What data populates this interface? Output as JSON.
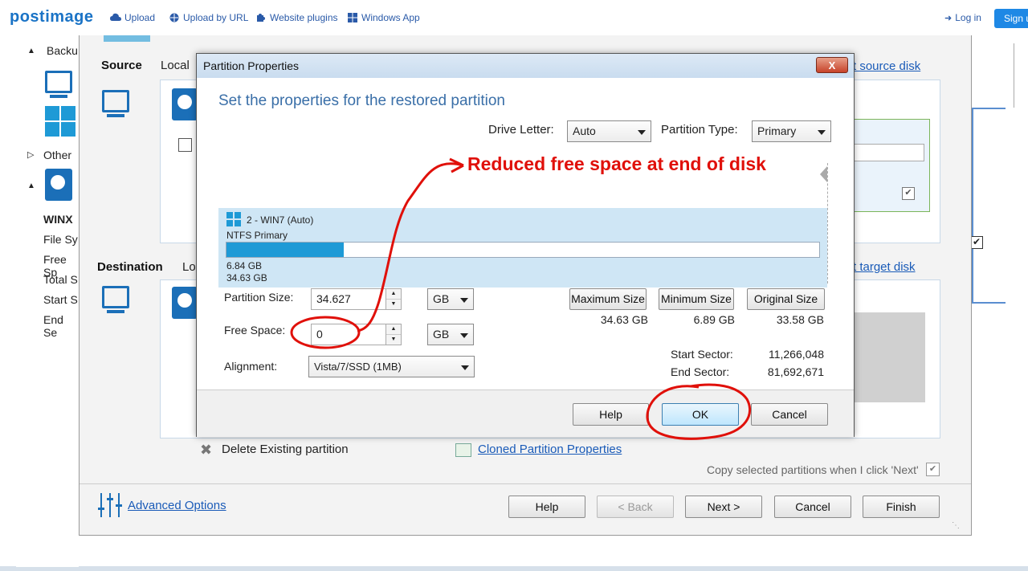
{
  "topbar": {
    "logo": "postimage",
    "nav": [
      "Upload",
      "Upload by URL",
      "Website plugins",
      "Windows App"
    ],
    "login": "Log in",
    "signup": "Sign up"
  },
  "left_panel": {
    "backup_label": "Backu",
    "other_label": "Other",
    "disk_name": "WINX",
    "props": [
      "File Sy",
      "Free Sp",
      "Total S",
      "Start S",
      "End Se"
    ]
  },
  "wizard": {
    "source_label": "Source",
    "source_local": "Local",
    "select_source_link": "t source disk",
    "destination_label": "Destination",
    "destination_local": "Lo",
    "select_target_link": "t target disk",
    "delete_partition": "Delete Existing partition",
    "cloned_props_link": "Cloned Partition Properties",
    "copy_note": "Copy selected partitions when I click 'Next'",
    "advanced_options": "Advanced Options",
    "buttons": {
      "help": "Help",
      "back": "< Back",
      "next": "Next >",
      "cancel": "Cancel",
      "finish": "Finish"
    }
  },
  "dialog": {
    "title": "Partition Properties",
    "close": "X",
    "heading": "Set the properties for the restored partition",
    "drive_letter_label": "Drive Letter:",
    "drive_letter_value": "Auto",
    "partition_type_label": "Partition Type:",
    "partition_type_value": "Primary",
    "partition": {
      "name": "2 - WIN7 (Auto)",
      "type": "NTFS Primary",
      "used": "6.84 GB",
      "total": "34.63 GB",
      "used_fraction": 0.198
    },
    "partition_size_label": "Partition Size:",
    "partition_size_value": "34.627",
    "partition_size_unit": "GB",
    "free_space_label": "Free Space:",
    "free_space_value": "0",
    "free_space_unit": "GB",
    "alignment_label": "Alignment:",
    "alignment_value": "Vista/7/SSD (1MB)",
    "max_size_btn": "Maximum Size",
    "min_size_btn": "Minimum Size",
    "orig_size_btn": "Original Size",
    "max_size_value": "34.63 GB",
    "min_size_value": "6.89 GB",
    "orig_size_value": "33.58 GB",
    "start_sector_label": "Start Sector:",
    "start_sector_value": "11,266,048",
    "end_sector_label": "End Sector:",
    "end_sector_value": "81,692,671",
    "buttons": {
      "help": "Help",
      "ok": "OK",
      "cancel": "Cancel"
    }
  },
  "annotation": {
    "text": "Reduced free space at end of disk",
    "color": "#e0100a"
  }
}
